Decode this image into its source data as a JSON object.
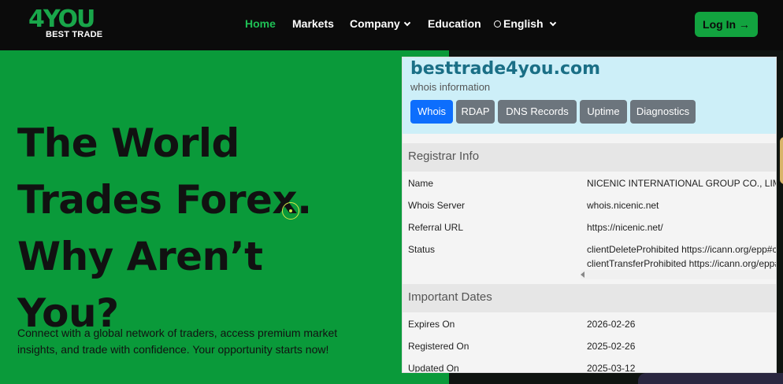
{
  "header": {
    "logo_top": "4YOU",
    "logo_bottom": "BEST TRADE",
    "nav": {
      "home": "Home",
      "markets": "Markets",
      "company": "Company",
      "education": "Education",
      "language": "English"
    },
    "login_label": "Log In →"
  },
  "hero": {
    "title_lines": [
      "The World",
      "Trades Forex.",
      "Why Aren’t",
      "You?"
    ],
    "subtitle": "Connect with a global network of traders, access premium market insights, and trade with confidence. Your opportunity starts now!"
  },
  "whois": {
    "domain": "besttrade4you.com",
    "subtitle": "whois information",
    "tabs": [
      "Whois",
      "RDAP",
      "DNS Records",
      "Uptime",
      "Diagnostics"
    ],
    "active_tab": "Whois",
    "registrar_section": "Registrar Info",
    "registrar": {
      "name_label": "Name",
      "name_value": "NICENIC INTERNATIONAL GROUP CO., LIMITED",
      "server_label": "Whois Server",
      "server_value": "whois.nicenic.net",
      "referral_label": "Referral URL",
      "referral_value": "https://nicenic.net/",
      "status_label": "Status",
      "status_value_1": "clientDeleteProhibited https://icann.org/epp#clientDeleteProhibited",
      "status_value_2": "clientTransferProhibited https://icann.org/epp#clientTransferProhibited"
    },
    "dates_section": "Important Dates",
    "dates": {
      "expires_label": "Expires On",
      "expires_value": "2026-02-26",
      "registered_label": "Registered On",
      "registered_value": "2025-02-26",
      "updated_label": "Updated On",
      "updated_value": "2025-03-12"
    }
  },
  "colors": {
    "brand_green": "#0a9a3a",
    "nav_active": "#1fbf55",
    "tab_active": "#0d6efd",
    "tab_inactive": "#6c757d",
    "whois_header_bg": "#cdeff8",
    "domain_color": "#1a6f86"
  },
  "icons": {
    "dropdown": "chevron-down-icon",
    "language": "globe-icon",
    "login_arrow": "arrow-right-icon"
  }
}
